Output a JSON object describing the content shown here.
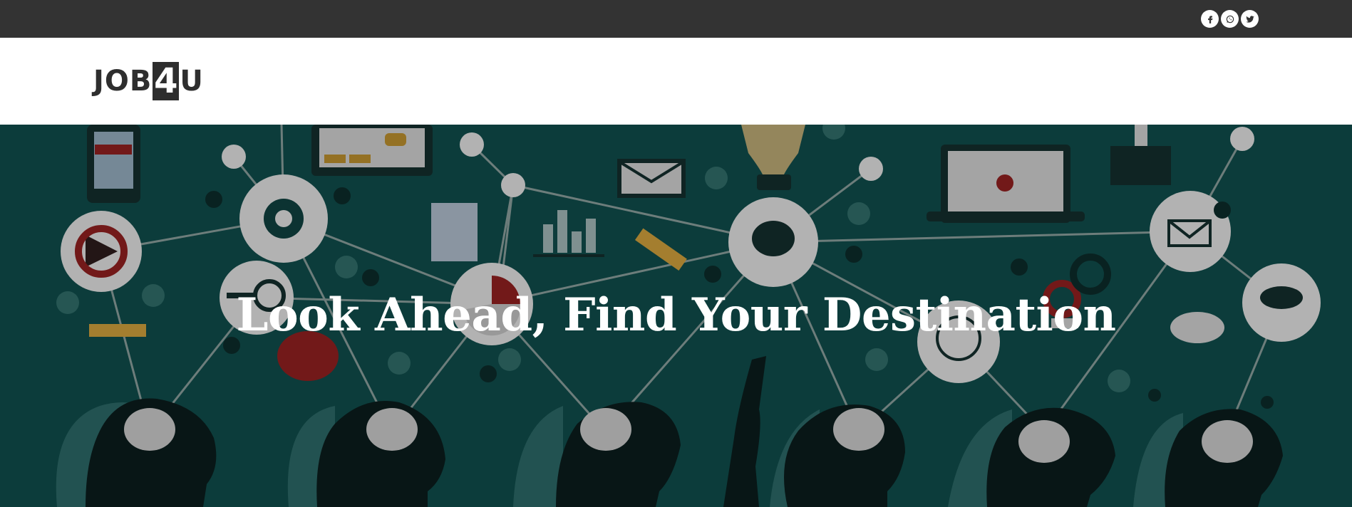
{
  "topbar": {
    "social": [
      {
        "name": "facebook",
        "icon": "facebook-icon"
      },
      {
        "name": "whatsapp",
        "icon": "whatsapp-icon"
      },
      {
        "name": "twitter",
        "icon": "twitter-icon"
      }
    ]
  },
  "brand": {
    "logo_left": "JOB",
    "logo_mid": "4",
    "logo_right": "U"
  },
  "hero": {
    "title": "Look Ahead, Find Your Destination",
    "background_description_icon": "network-people-illustration"
  },
  "colors": {
    "topbar": "#333333",
    "hero_bg": "#0f4a48",
    "logo": "#2e2e2e",
    "hero_title": "#ffffff"
  }
}
